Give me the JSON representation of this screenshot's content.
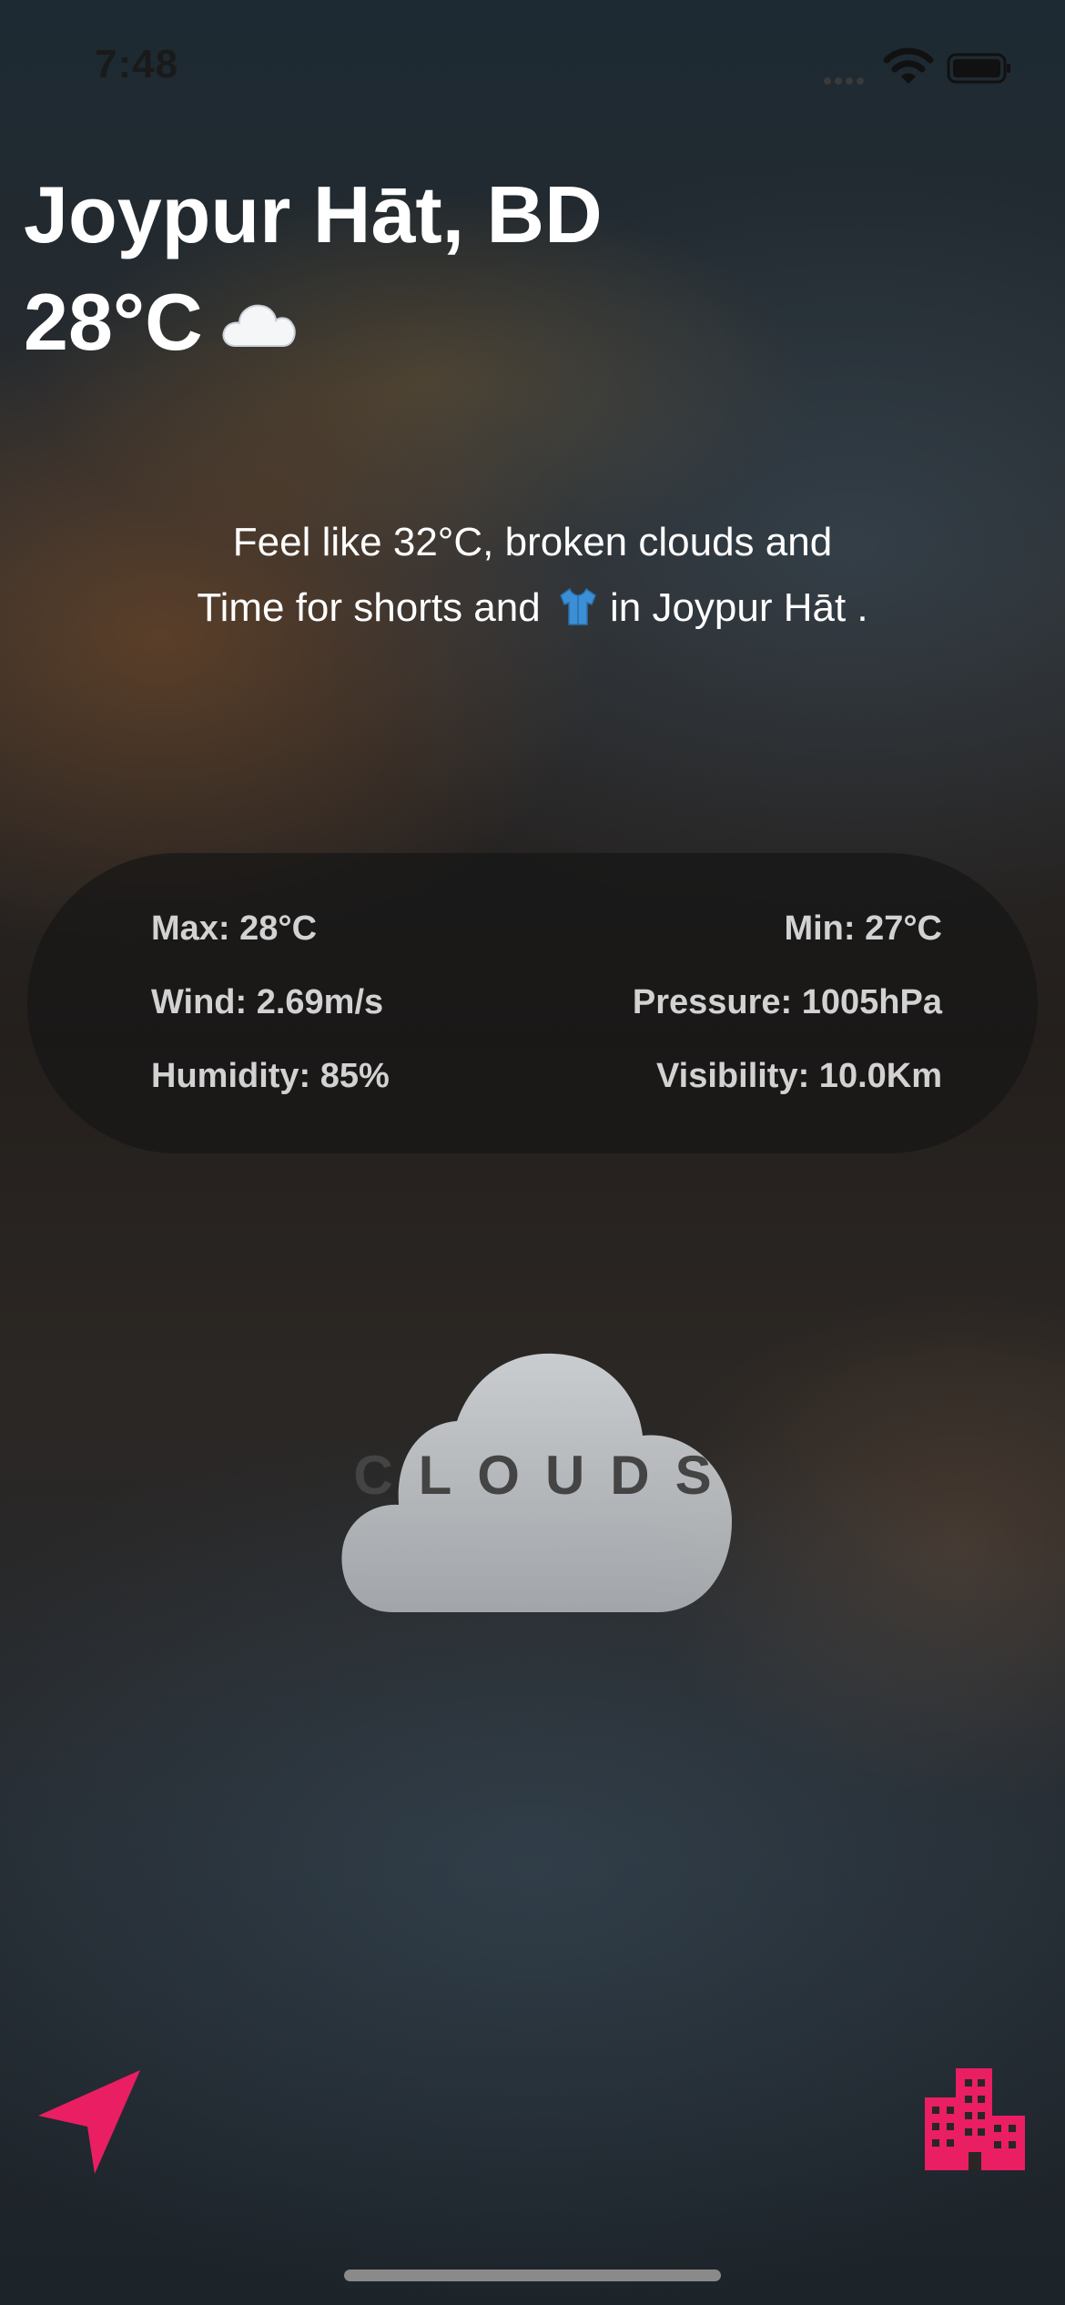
{
  "status_bar": {
    "time": "7:48"
  },
  "location": {
    "city": "Joypur Hāt, BD"
  },
  "current": {
    "temperature": "28°C",
    "icon": "cloud-icon"
  },
  "description": {
    "line1": "Feel like 32°C, broken clouds and",
    "line2_before": "Time for shorts and",
    "line2_icon": "t-shirt-icon",
    "line2_after": "in Joypur Hāt ."
  },
  "stats": {
    "max": "Max: 28°C",
    "min": "Min: 27°C",
    "wind": "Wind: 2.69m/s",
    "pressure": "Pressure: 1005hPa",
    "humidity": "Humidity: 85%",
    "visibility": "Visibility: 10.0Km"
  },
  "condition": {
    "label": "CLOUDS",
    "icon": "cloud-icon"
  },
  "controls": {
    "left_icon": "location-arrow-icon",
    "right_icon": "city-buildings-icon"
  },
  "colors": {
    "accent": "#E91E63"
  }
}
